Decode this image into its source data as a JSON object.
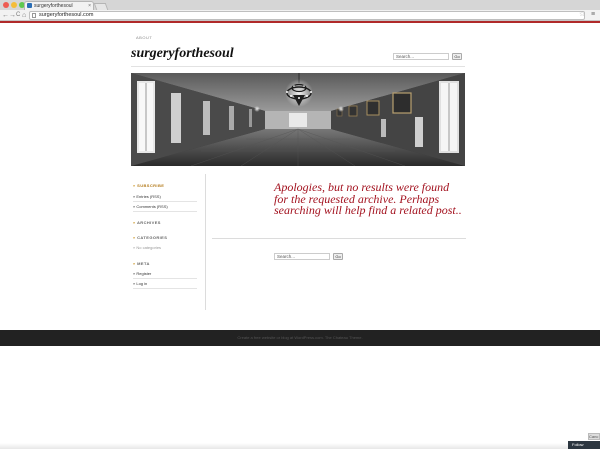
{
  "browser": {
    "tab_title": "surgeryforthesoul",
    "tab_close": "×",
    "url": "surgeryforthesoul.com",
    "nav_back": "←",
    "nav_forward": "→",
    "nav_reload": "C",
    "nav_home": "⌂",
    "star": "☆",
    "menu": "≡"
  },
  "header": {
    "about_link": "ABOUT",
    "site_title": "surgeryforthesoul",
    "search_placeholder": "Search...",
    "go_label": "Go"
  },
  "sidebar": {
    "bullet": "»",
    "sections": [
      {
        "heading": "SUBSCRIBE",
        "items": [
          "Entries (RSS)",
          "Comments (RSS)"
        ]
      },
      {
        "heading": "ARCHIVES",
        "items": []
      },
      {
        "heading": "CATEGORIES",
        "items": [
          "No categories"
        ]
      },
      {
        "heading": "META",
        "items": [
          "Register",
          "Log in"
        ]
      }
    ]
  },
  "main": {
    "message": "Apologies, but no results were found for the requested archive. Perhaps searching will help find a related post..",
    "search_placeholder": "Search...",
    "go_label": "Go"
  },
  "footer": {
    "text": "Create a free website or blog at WordPress.com. The Chateau Theme."
  },
  "widgets": {
    "follow_label": "Follow",
    "cancel_label": "Canc"
  },
  "colors": {
    "accent_red": "#a3121f",
    "accent_orange": "#c8901a",
    "footer_bg": "#222222"
  }
}
